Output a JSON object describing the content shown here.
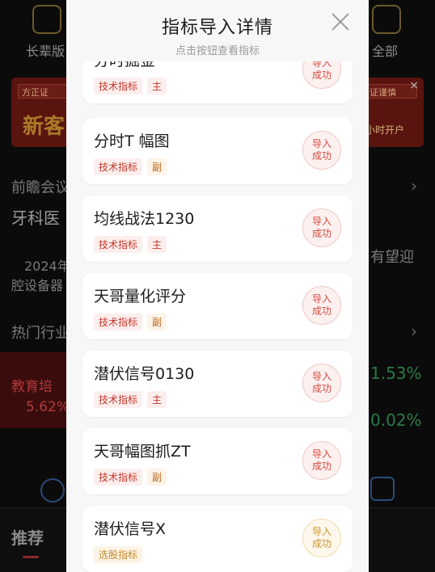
{
  "background": {
    "top_left_label": "长辈版",
    "top_right_label": "全部",
    "banner_left_brand": "方正证",
    "banner_left_big": "新客",
    "banner_right_brand": "证谨慎",
    "banner_right_small": "小时开户",
    "section1_title": "前瞻会议",
    "section1_subtitle": "牙科医",
    "section1_line1": "2024年",
    "section1_line2": "腔设备器",
    "section1_right": "有望迎",
    "section2_title": "热门行业",
    "hot_name": "教育培",
    "hot_pct": "5.62%",
    "green_pct_1": "1.53%",
    "green_pct_2": "0.02%",
    "bottom_tab": "推荐"
  },
  "modal": {
    "title": "指标导入详情",
    "subtitle": "点击按钮查看指标",
    "items": [
      {
        "name": "分时掘金",
        "type_tag": "技术指标",
        "level_tag": "主",
        "status": "导入成功",
        "status_line1": "导入",
        "status_line2": "成功"
      },
      {
        "name": "分时T 幅图",
        "type_tag": "技术指标",
        "level_tag": "副",
        "status": "导入成功",
        "status_line1": "导入",
        "status_line2": "成功"
      },
      {
        "name": "均线战法1230",
        "type_tag": "技术指标",
        "level_tag": "主",
        "status": "导入成功",
        "status_line1": "导入",
        "status_line2": "成功"
      },
      {
        "name": "天哥量化评分",
        "type_tag": "技术指标",
        "level_tag": "副",
        "status": "导入成功",
        "status_line1": "导入",
        "status_line2": "成功"
      },
      {
        "name": "潜伏信号0130",
        "type_tag": "技术指标",
        "level_tag": "主",
        "status": "导入成功",
        "status_line1": "导入",
        "status_line2": "成功"
      },
      {
        "name": "天哥幅图抓ZT",
        "type_tag": "技术指标",
        "level_tag": "副",
        "status": "导入成功",
        "status_line1": "导入",
        "status_line2": "成功"
      },
      {
        "name": "潜伏信号X",
        "type_tag": "选股指标",
        "level_tag": "",
        "status": "导入成功",
        "status_line1": "导入",
        "status_line2": "成功"
      }
    ]
  },
  "colors": {
    "success_red": "#d24a40",
    "success_amber": "#c9962c",
    "tag_red": "#c0392b",
    "tag_orange": "#b86a1f"
  }
}
